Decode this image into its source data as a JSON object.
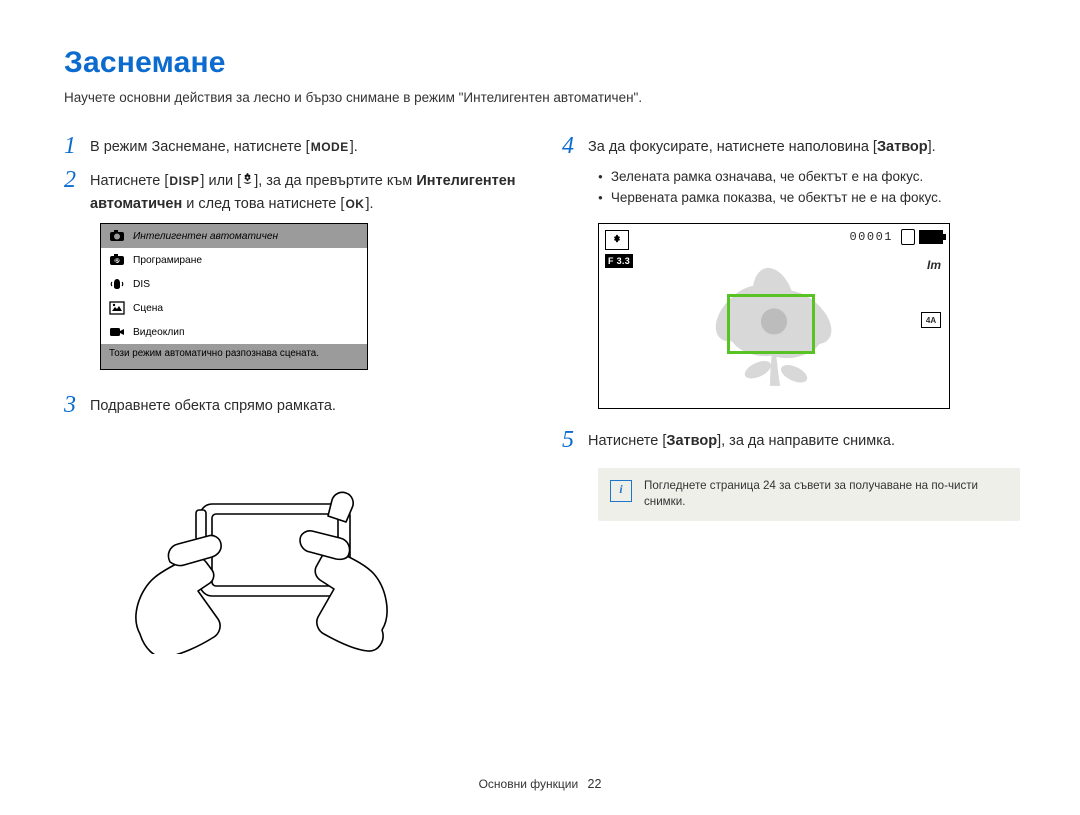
{
  "title": "Заснемане",
  "intro": "Научете основни действия за лесно и бързо снимане в режим \"Интелигентен автоматичен\".",
  "steps": {
    "s1": {
      "num": "1",
      "pre": "В режим Заснемане, натиснете [",
      "btn": "MODE",
      "post": "]."
    },
    "s2": {
      "num": "2",
      "pre": "Натиснете [",
      "btn1": "DISP",
      "mid1": "] или [",
      "icon": "flower",
      "mid2": "], за да превъртите към ",
      "boldPhrase": "Интелигентен автоматичен",
      "post1": " и след това натиснете [",
      "btn2": "OK",
      "post2": "]."
    },
    "s3": {
      "num": "3",
      "text": "Подравнете обекта спрямо рамката."
    },
    "s4": {
      "num": "4",
      "pre": "За да фокусирате, натиснете наполовина [",
      "boldBtn": "Затвор",
      "post": "].",
      "bullets": [
        "Зелената рамка означава, че обектът е на фокус.",
        "Червената рамка показва, че обектът не е на фокус."
      ]
    },
    "s5": {
      "num": "5",
      "pre": "Натиснете [",
      "boldBtn": "Затвор",
      "post": "], за да направите снимка."
    }
  },
  "mode_menu": {
    "items": [
      {
        "label": "Интелигентен автоматичен",
        "selected": true
      },
      {
        "label": "Програмиране",
        "selected": false
      },
      {
        "label": "DIS",
        "selected": false
      },
      {
        "label": "Сцена",
        "selected": false
      },
      {
        "label": "Видеоклип",
        "selected": false
      }
    ],
    "caption": "Този режим автоматично разпознава сцената."
  },
  "preview": {
    "f_number": "F 3.3",
    "counter": "00001",
    "size_label": "Im",
    "flash_label": "4A"
  },
  "info_box": "Погледнете страница 24 за съвети за получаване на по-чисти снимки.",
  "footer": {
    "section": "Основни функции",
    "page": "22"
  },
  "colors": {
    "accent": "#0b6bcf",
    "focus_rect": "#58c322"
  }
}
